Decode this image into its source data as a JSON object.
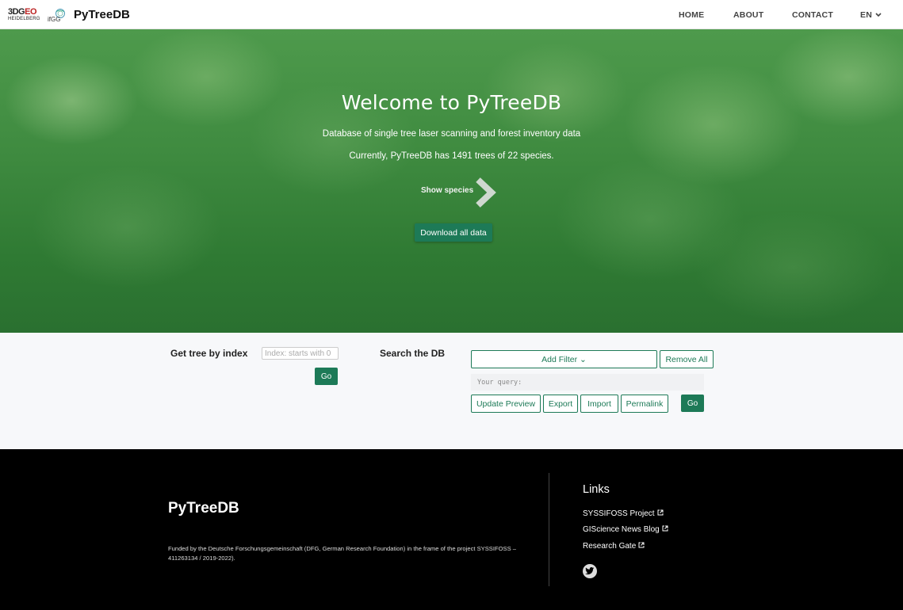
{
  "navbar": {
    "logo_3dgeo_top_a": "3DG",
    "logo_3dgeo_top_b": "EO",
    "logo_3dgeo_bottom": "HEIDELBERG",
    "logo_ifgg": "ifGG",
    "brand": "PyTreeDB",
    "items": [
      {
        "label": "HOME"
      },
      {
        "label": "ABOUT"
      },
      {
        "label": "CONTACT"
      }
    ],
    "language": "EN"
  },
  "hero": {
    "title": "Welcome to PyTreeDB",
    "subtitle": "Database of single tree laser scanning and forest inventory data",
    "count_text": "Currently, PyTreeDB has 1491 trees of 22 species.",
    "show_species": "Show species",
    "download_button": "Download all data"
  },
  "get_tree": {
    "label": "Get tree by index",
    "placeholder": "Index: starts with 0",
    "go": "Go"
  },
  "search": {
    "label": "Search the DB",
    "add_filter": "Add Filter ⌄",
    "remove_all": "Remove All",
    "query_placeholder": "Your query:",
    "update_preview": "Update Preview",
    "export": "Export",
    "import": "Import",
    "permalink": "Permalink",
    "go": "Go"
  },
  "footer": {
    "brand": "PyTreeDB",
    "funding": "Funded by the Deutsche Forschungsgemeinschaft (DFG, German Research Foundation) in the frame of the project SYSSIFOSS – 411263134 / 2019-2022).",
    "links_title": "Links",
    "links": [
      {
        "label": "SYSSIFOSS Project"
      },
      {
        "label": "GIScience News Blog"
      },
      {
        "label": "Research Gate"
      }
    ]
  },
  "colors": {
    "accent": "#1d7a57",
    "footer_bg": "#000000",
    "search_bg": "#f7f8fa"
  },
  "icons": [
    "twitter-icon",
    "external-link-icon",
    "chevron-right-icon",
    "chevron-down-icon"
  ]
}
